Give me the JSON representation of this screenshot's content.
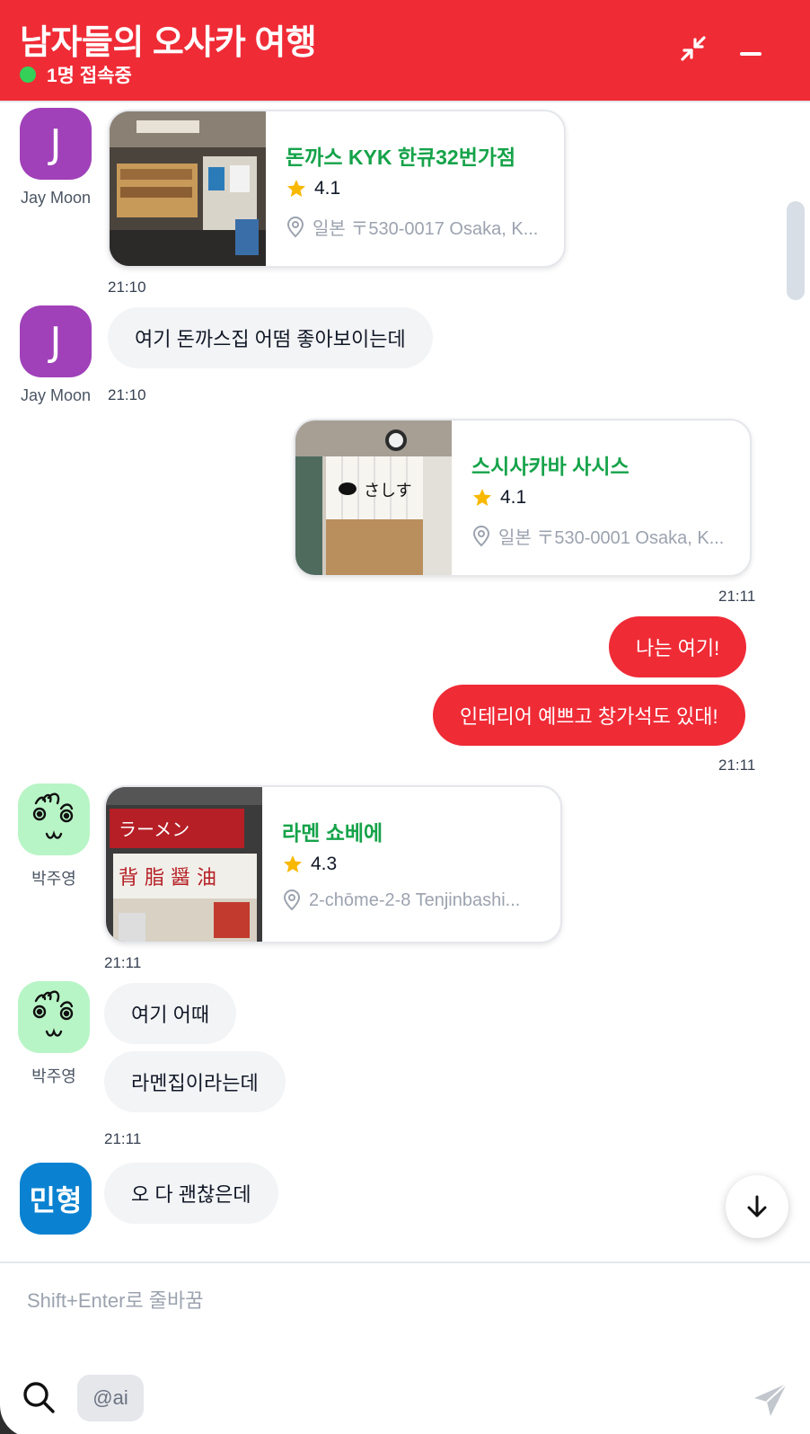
{
  "header": {
    "title": "남자들의 오사카 여행",
    "status": "1명 접속중",
    "color": "#ef2b36"
  },
  "icons": {
    "minimize_to_corner": "collapse-arrows-icon",
    "minimize": "minus-icon",
    "scroll_down": "arrow-down-icon",
    "search": "search-icon",
    "send": "send-icon",
    "star": "star-icon",
    "pin": "location-pin-icon"
  },
  "messages": {
    "m1": {
      "avatar": "J",
      "sender": "Jay Moon",
      "time": "21:10",
      "card": {
        "name": "돈까스 KYK 한큐32번가점",
        "rating": "4.1",
        "address": "일본 〒530-0017 Osaka, K..."
      }
    },
    "m2": {
      "avatar": "J",
      "sender": "Jay Moon",
      "time": "21:10",
      "text": "여기 돈까스집 어떰 좋아보이는데"
    },
    "m3": {
      "time": "21:11",
      "card": {
        "name": "스시사카바 사시스",
        "rating": "4.1",
        "address": "일본 〒530-0001 Osaka, K..."
      }
    },
    "m4": {
      "text": "나는 여기!"
    },
    "m5": {
      "text": "인테리어 예쁘고 창가석도 있대!",
      "time": "21:11"
    },
    "m6": {
      "sender": "박주영",
      "time": "21:11",
      "card": {
        "name": "라멘 쇼베에",
        "rating": "4.3",
        "address": "2-chōme-2-8 Tenjinbashi..."
      }
    },
    "m7": {
      "sender": "박주영",
      "text": "여기 어때"
    },
    "m8": {
      "text": "라멘집이라는데",
      "time": "21:11"
    },
    "m9": {
      "avatar": "민형",
      "text": "오 다 괜찮은데"
    }
  },
  "composer": {
    "placeholder": "Shift+Enter로 줄바꿈",
    "ai_chip": "@ai"
  }
}
